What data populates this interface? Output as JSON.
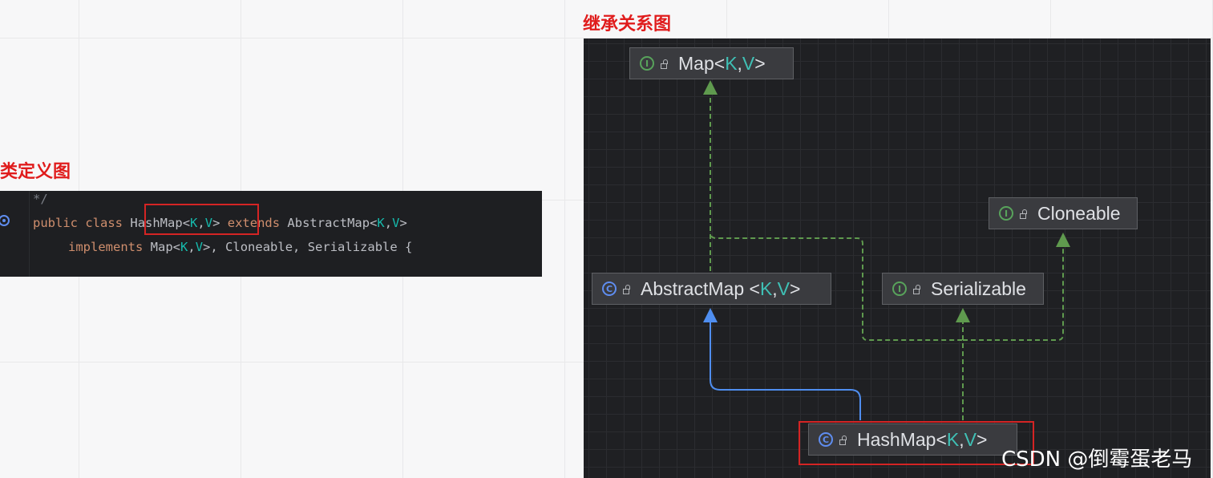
{
  "left_heading": "类定义图",
  "right_heading": "继承关系图",
  "code": {
    "line0": "*/",
    "line1": {
      "public": "public",
      "class": "class",
      "name": "HashMap",
      "lt": "<",
      "k": "K",
      "comma": ",",
      "v": "V",
      "gt": ">",
      "extends": "extends",
      "parent": "AbstractMap",
      "plt": "<",
      "pk": "K",
      "pcomma": ",",
      "pv": "V",
      "pgt": ">"
    },
    "line2": {
      "implements": "implements",
      "map": "Map",
      "mlt": "<",
      "mk": "K",
      "mcomma": ",",
      "mv": "V",
      "mgt": ">",
      "rest": ", Cloneable, Serializable {"
    }
  },
  "diagram": {
    "nodes": {
      "map": {
        "badge": "I",
        "name": "Map",
        "lt": "<",
        "k": "K",
        "sep": ", ",
        "v": "V",
        "gt": ">"
      },
      "cloneable": {
        "badge": "I",
        "name": "Cloneable"
      },
      "abstract_map": {
        "badge": "C",
        "name": "AbstractMap",
        "lt": "<",
        "k": "K",
        "sep": ", ",
        "v": "V",
        "gt": ">"
      },
      "serializable": {
        "badge": "I",
        "name": "Serializable"
      },
      "hash_map": {
        "badge": "C",
        "name": "HashMap",
        "lt": "<",
        "k": "K",
        "sep": ", ",
        "v": "V",
        "gt": ">"
      }
    },
    "edges": [
      {
        "from": "abstract_map",
        "to": "map",
        "kind": "implements"
      },
      {
        "from": "hash_map",
        "to": "map",
        "kind": "implements"
      },
      {
        "from": "hash_map",
        "to": "abstract_map",
        "kind": "extends"
      },
      {
        "from": "hash_map",
        "to": "serializable",
        "kind": "implements"
      },
      {
        "from": "hash_map",
        "to": "cloneable",
        "kind": "implements"
      }
    ],
    "colors": {
      "implements": "#5f9a4e",
      "extends": "#4f8ef0",
      "highlight": "#d42424"
    }
  },
  "watermark": "CSDN @倒霉蛋老马"
}
